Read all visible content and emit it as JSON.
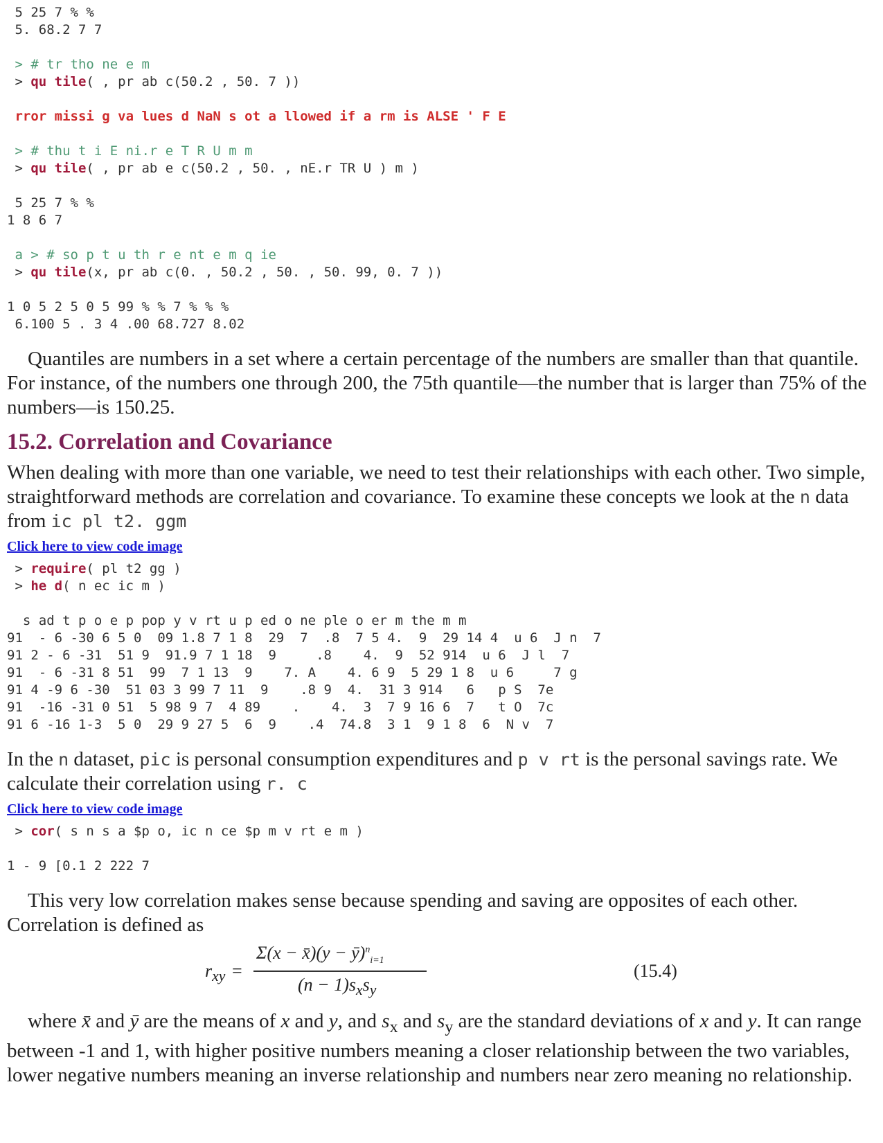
{
  "code_top": {
    "out1a": " 5 25 7 % %",
    "out1b": " 5. 68.2 7 7",
    "cmt1": " > # tr tho ne e m",
    "cmd1_kw": "qu tile",
    "cmd1_rest": "( , pr ab c(50.2 , 50. 7 ))",
    "err1": " rror missi g va lues d NaN s ot a llowed if a rm is ALSE ' F E",
    "cmt2": " > # thu t i E ni.r e T R U m m",
    "cmd2_kw": "qu tile",
    "cmd2_rest": "( , pr ab e c(50.2 , 50. , nE.r TR U ) m )",
    "out2a": " 5 25 7 % %",
    "out2b": "1 8 6 7",
    "cmt3": " a > # so p t u th r e nt e m q ie",
    "cmd3_kw": "qu tile",
    "cmd3_rest": "(x, pr ab c(0. , 50.2 , 50. , 50. 99, 0. 7 ))",
    "out3a": "1 0 5 2 5 0 5 99 % % 7 % % %",
    "out3b": " 6.100 5 . 3 4 .00 68.727 8.02"
  },
  "para_quantiles": "Quantiles are numbers in a set where a certain percentage of the numbers are smaller than that quantile. For instance, of the numbers one through 200, the 75th quantile—the number that is larger than 75% of the numbers—is 150.25.",
  "section_heading": "15.2. Correlation and Covariance",
  "para_intro_text": "When dealing with more than one variable, we need to test their relationships with each other. Two simple, straightforward methods are correlation and covariance. To examine these concepts we look at the",
  "para_intro_code1": "n",
  "para_intro_text2": "data from",
  "para_intro_code2": "ic pl t2. ggm",
  "link_view_code": "Click here to view code image",
  "code_mid": {
    "cmd1_kw": "require",
    "cmd1_rest": "( pl t2 gg )",
    "cmd2_kw": "he d",
    "cmd2_rest": "( n ec ic m )",
    "hdr": "  s ad t p o e p pop y v rt u p ed o ne ple o er m the m m",
    "rows": [
      "91  - 6 -30 6 5 0  09 1.8 7 1 8  29  7  .8  7 5 4.  9  29 14 4  u 6  J n  7",
      "91 2 - 6 -31  51 9  91.9 7 1 18  9     .8    4.  9  52 914  u 6  J l  7",
      "91  - 6 -31 8 51  99  7 1 13  9    7. A    4. 6 9  5 29 1 8  u 6     7 g",
      "91 4 -9 6 -30  51 03 3 99 7 11  9    .8 9  4.  31 3 914   6   p S  7e",
      "91  -16 -31 0 51  5 98 9 7  4 89    .    4.  3  7 9 16 6  7   t O  7c",
      "91 6 -16 1-3  5 0  29 9 27 5  6  9    .4  74.8  3 1  9 1 8  6  N v  7"
    ]
  },
  "para_dataset": {
    "t1": "In the",
    "c1": "n",
    "t2": "dataset,",
    "c2": "pic",
    "t3": "is personal consumption expenditures and",
    "c3": "p v rt",
    "t4": "is the personal savings rate. We calculate their correlation using",
    "c4": "r. c"
  },
  "link_view_code_2": "Click here to view code image",
  "code_bottom": {
    "cmd_kw": "cor",
    "cmd_rest": "( s n s a $p o, ic n ce $p m v rt e m )",
    "out": "1 - 9 [0.1 2 222 7"
  },
  "para_low_corr": "This very low correlation makes sense because spending and saving are opposites of each other. Correlation is defined as",
  "formula": {
    "lhs": "r",
    "lhs_sub": "xy",
    "numerator": "Σ(x − x̄)(y − ȳ)",
    "sum_top": "n",
    "sum_bottom": "i=1",
    "denominator": "(n − 1)s",
    "den_sub_x": "x",
    "den_s": "s",
    "den_sub_y": "y",
    "tag": "(15.4)"
  },
  "para_where": {
    "t1": "where",
    "xbar": "x̄",
    "t2": "and",
    "ybar": "ȳ",
    "t3": "are the means of",
    "x1": "x",
    "t4": "and",
    "y1": "y",
    "t5": ", and",
    "sx": "s",
    "sx_sub": "x",
    "t6": "and",
    "sy": "s",
    "sy_sub": "y",
    "t7": "are the standard deviations of",
    "x2": "x",
    "t8": "and",
    "y2": "y",
    "t9": ". It can range between -1 and 1, with higher positive numbers meaning a closer relationship between the two variables, lower negative numbers meaning an inverse relationship and numbers near zero meaning no relationship."
  }
}
